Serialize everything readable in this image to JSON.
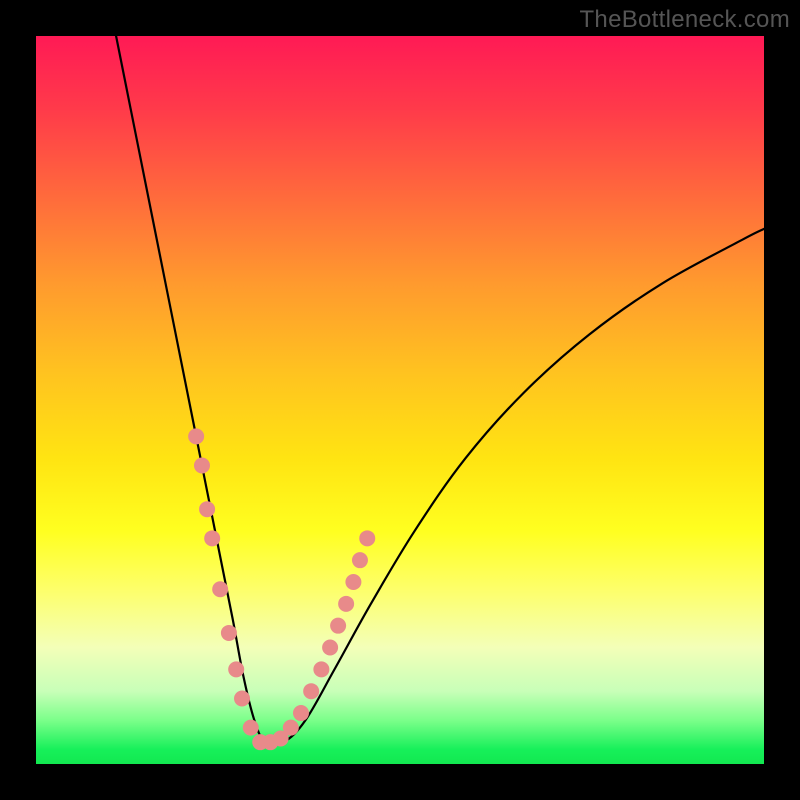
{
  "watermark": "TheBottleneck.com",
  "chart_data": {
    "type": "line",
    "title": "",
    "xlabel": "",
    "ylabel": "",
    "ylim": [
      0,
      100
    ],
    "xlim": [
      0,
      100
    ],
    "series": [
      {
        "name": "curve",
        "x": [
          11,
          13,
          15,
          17,
          19,
          21,
          23,
          25,
          27,
          28.5,
          30,
          31.5,
          34,
          37,
          41,
          46,
          52,
          59,
          67,
          76,
          86,
          97,
          100
        ],
        "y": [
          100,
          90,
          80,
          70,
          60,
          50,
          40,
          30,
          20,
          12,
          6,
          3,
          3,
          6,
          13,
          22,
          32,
          42,
          51,
          59,
          66,
          72,
          73.5
        ]
      }
    ],
    "markers": {
      "color": "#e88a8a",
      "radius": 8,
      "points": [
        {
          "x": 22.0,
          "y": 45
        },
        {
          "x": 22.8,
          "y": 41
        },
        {
          "x": 23.5,
          "y": 35
        },
        {
          "x": 24.2,
          "y": 31
        },
        {
          "x": 25.3,
          "y": 24
        },
        {
          "x": 26.5,
          "y": 18
        },
        {
          "x": 27.5,
          "y": 13
        },
        {
          "x": 28.3,
          "y": 9
        },
        {
          "x": 29.5,
          "y": 5
        },
        {
          "x": 30.8,
          "y": 3
        },
        {
          "x": 32.2,
          "y": 3
        },
        {
          "x": 33.6,
          "y": 3.5
        },
        {
          "x": 35.0,
          "y": 5
        },
        {
          "x": 36.4,
          "y": 7
        },
        {
          "x": 37.8,
          "y": 10
        },
        {
          "x": 39.2,
          "y": 13
        },
        {
          "x": 40.4,
          "y": 16
        },
        {
          "x": 41.5,
          "y": 19
        },
        {
          "x": 42.6,
          "y": 22
        },
        {
          "x": 43.6,
          "y": 25
        },
        {
          "x": 44.5,
          "y": 28
        },
        {
          "x": 45.5,
          "y": 31
        }
      ]
    }
  }
}
